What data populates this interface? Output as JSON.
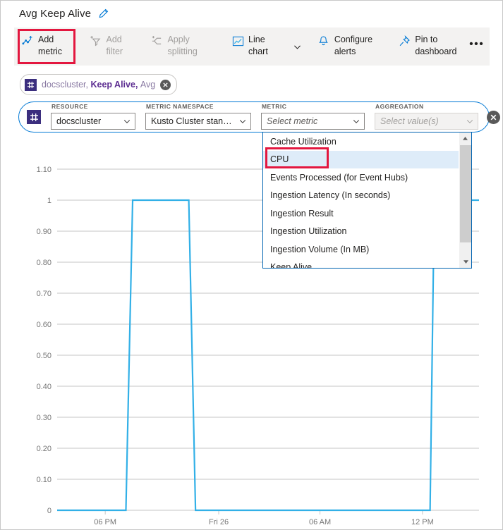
{
  "header": {
    "title": "Avg Keep Alive",
    "edit_icon": "pencil-icon"
  },
  "toolbar": {
    "items": [
      {
        "label": "Add metric",
        "icon": "add-metric-icon",
        "enabled": true,
        "highlighted": true
      },
      {
        "label": "Add filter",
        "icon": "add-filter-icon",
        "enabled": false,
        "highlighted": false
      },
      {
        "label": "Apply splitting",
        "icon": "apply-splitting-icon",
        "enabled": false,
        "highlighted": false
      },
      {
        "label": "Line chart",
        "icon": "line-chart-icon",
        "enabled": true,
        "highlighted": false
      },
      {
        "label": "Configure alerts",
        "icon": "bell-icon",
        "enabled": true,
        "highlighted": false
      },
      {
        "label": "Pin to dashboard",
        "icon": "pin-icon",
        "enabled": true,
        "highlighted": false
      }
    ],
    "chart_type_caret": "chevron-down-icon",
    "more_label": "•••",
    "highlight_color": "#e3173f"
  },
  "series_chip": {
    "glyph_icon": "metric-glyph-icon",
    "resource": "docscluster",
    "separator1": ", ",
    "metric": "Keep Alive",
    "separator2": ", ",
    "aggregation": "Avg",
    "close_icon": "close-icon",
    "accent_color": "#5c2d91"
  },
  "picker": {
    "glyph_icon": "metric-glyph-icon",
    "remove_icon": "close-icon",
    "border_color": "#0078d4",
    "fields": [
      {
        "label": "RESOURCE",
        "value": "docscluster",
        "placeholder": "",
        "is_placeholder": false,
        "disabled": false
      },
      {
        "label": "METRIC NAMESPACE",
        "value": "Kusto Cluster stand...",
        "placeholder": "",
        "is_placeholder": false,
        "disabled": false
      },
      {
        "label": "METRIC",
        "value": "",
        "placeholder": "Select metric",
        "is_placeholder": true,
        "disabled": false
      },
      {
        "label": "AGGREGATION",
        "value": "",
        "placeholder": "Select value(s)",
        "is_placeholder": true,
        "disabled": true
      }
    ]
  },
  "metric_dropdown": {
    "open": true,
    "highlight_color": "#e3173f",
    "selected_index": 1,
    "items": [
      "Cache Utilization",
      "CPU",
      "Events Processed (for Event Hubs)",
      "Ingestion Latency (In seconds)",
      "Ingestion Result",
      "Ingestion Utilization",
      "Ingestion Volume (In MB)",
      "Keep Alive"
    ],
    "scroll_up_icon": "triangle-up-icon",
    "scroll_down_icon": "triangle-down-icon"
  },
  "chart_data": {
    "type": "line",
    "title": "Avg Keep Alive",
    "xlabel": "",
    "ylabel": "",
    "grid": true,
    "legend": "none",
    "line_color": "#32b0e7",
    "ylim": [
      0,
      1.1
    ],
    "yticks": [
      "0",
      "0.10",
      "0.20",
      "0.30",
      "0.40",
      "0.50",
      "0.60",
      "0.70",
      "0.80",
      "0.90",
      "1",
      "1.10"
    ],
    "ytick_values": [
      0,
      0.1,
      0.2,
      0.3,
      0.4,
      0.5,
      0.6,
      0.7,
      0.8,
      0.9,
      1,
      1.1
    ],
    "xticks": [
      "06 PM",
      "Fri 26",
      "06 AM",
      "12 PM"
    ],
    "xtick_fractions": [
      0.114,
      0.383,
      0.623,
      0.866
    ],
    "series": [
      {
        "name": "docscluster, Keep Alive, Avg",
        "x_fractions": [
          0.0,
          0.163,
          0.179,
          0.312,
          0.328,
          0.884,
          0.894,
          1.0
        ],
        "values": [
          0,
          0,
          1,
          1,
          0,
          0,
          1,
          1
        ]
      }
    ]
  }
}
